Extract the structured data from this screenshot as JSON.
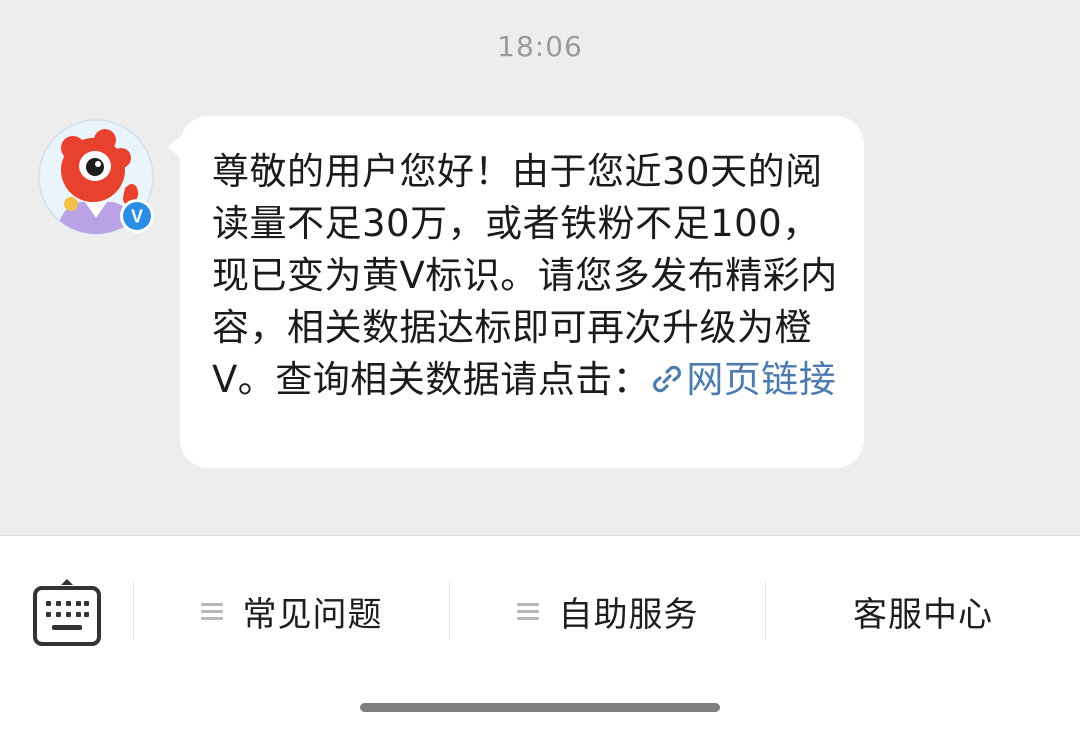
{
  "chat": {
    "timestamp": "18:06",
    "message": {
      "text": "尊敬的用户您好！由于您近30天的阅读量不足30万，或者铁粉不足100，现已变为黄V标识。请您多发布精彩内容，相关数据达标即可再次升级为橙V。查询相关数据请点击：",
      "link_label": "网页链接",
      "link_icon": "link-icon"
    },
    "avatar": {
      "icon": "weibo-mascot-icon",
      "verified_badge": "V"
    }
  },
  "bottom_bar": {
    "keyboard_icon": "keyboard-icon",
    "items": [
      {
        "label": "常见问题",
        "icon": "menu-lines-icon"
      },
      {
        "label": "自助服务",
        "icon": "menu-lines-icon"
      },
      {
        "label": "客服中心"
      }
    ]
  },
  "colors": {
    "chat_background": "#ededed",
    "bubble": "#ffffff",
    "link": "#4d7bb0",
    "verified_badge": "#2b8de4",
    "mascot": "#e8412e"
  }
}
